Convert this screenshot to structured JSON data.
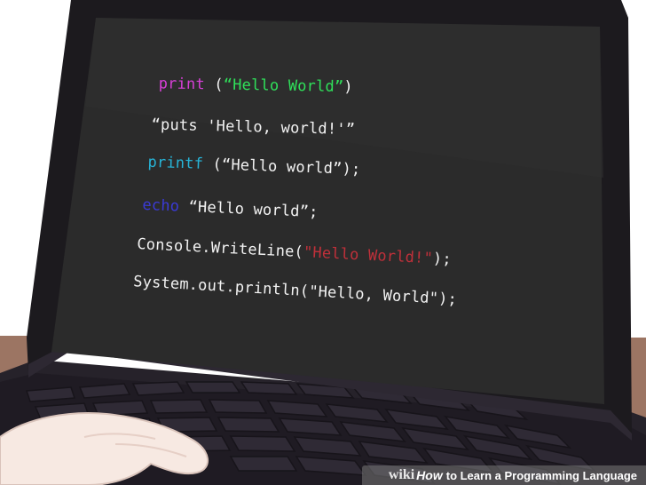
{
  "colors": {
    "screen": "#2b2b2b",
    "bezel": "#1c1a1e",
    "desk": "#9c7563",
    "skin": "#f7e9e2",
    "keyword_print": "#d63fd6",
    "keyword_printf": "#27b3d6",
    "keyword_echo": "#3a3ad6",
    "string_green": "#2fe05a",
    "string_red": "#c0303a"
  },
  "code": {
    "line1": {
      "keyword": "print",
      "pre": " (",
      "string": "“Hello World”",
      "post": ")"
    },
    "line2": {
      "text": "“puts 'Hello, world!'”"
    },
    "line3": {
      "keyword": "printf",
      "rest": " (“Hello world”);"
    },
    "line4": {
      "keyword": "echo",
      "rest": " “Hello world”;"
    },
    "line5": {
      "pre": "Console.WriteLine(",
      "string": "\"Hello World!\"",
      "post": ");"
    },
    "line6": {
      "text": "System.out.println(\"Hello, World\");"
    }
  },
  "watermark": {
    "wiki": "wiki",
    "how": "How",
    "title": "to Learn a Programming Language"
  }
}
